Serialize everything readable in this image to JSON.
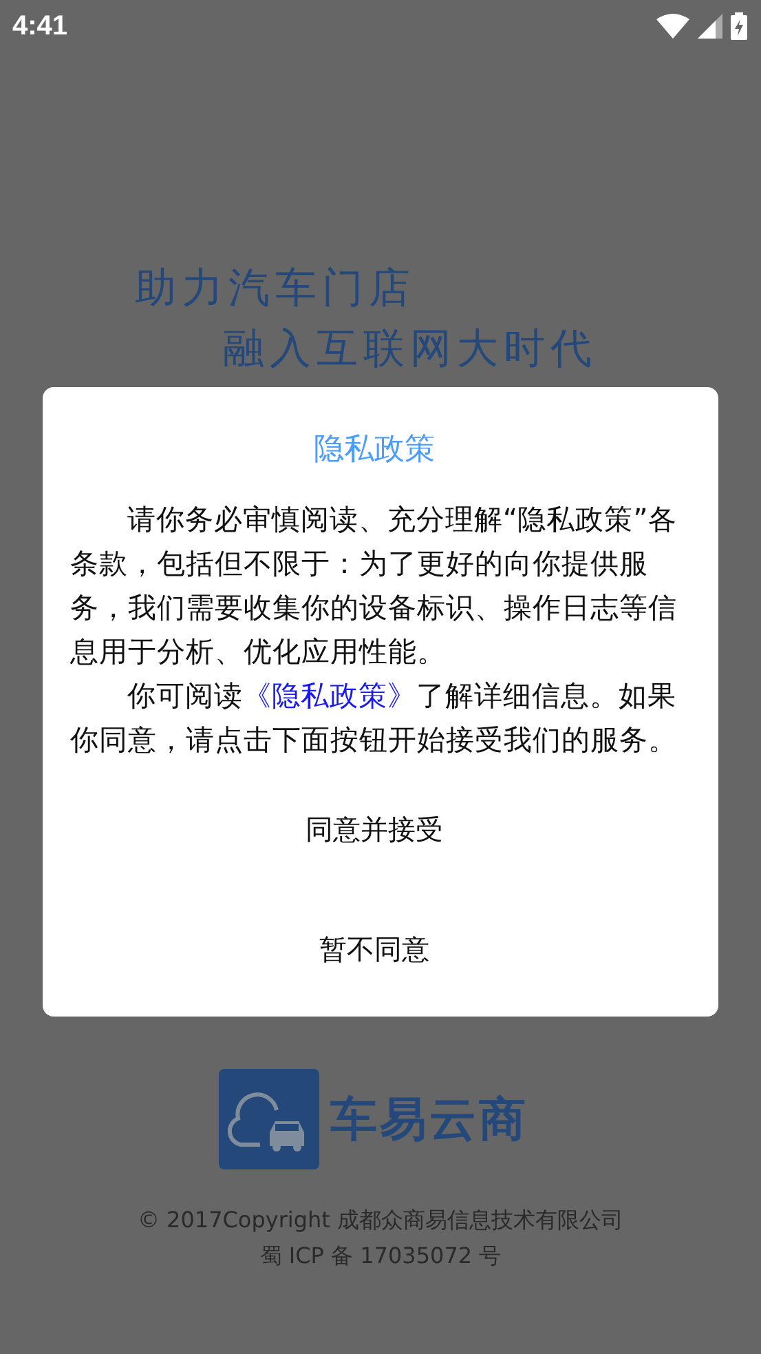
{
  "status_bar": {
    "time": "4:41"
  },
  "splash": {
    "slogan_lines": [
      "助力汽车门店",
      "融入互联网大时代"
    ],
    "brand": "车易云商",
    "copyright": "© 2017Copyright 成都众商易信息技术有限公司",
    "icp": "蜀 ICP 备 17035072 号"
  },
  "dialog": {
    "title": "隐私政策",
    "paragraph_1": "请你务必审慎阅读、充分理解“隐私政策”各条款，包括但不限于：为了更好的向你提供服务，我们需要收集你的设备标识、操作日志等信息用于分析、优化应用性能。",
    "paragraph_2_before": "你可阅读",
    "paragraph_2_link": "《隐私政策》",
    "paragraph_2_after": "了解详细信息。如果你同意，请点击下面按钮开始接受我们的服务。",
    "buttons": [
      "同意并接受",
      "暂不同意"
    ]
  }
}
